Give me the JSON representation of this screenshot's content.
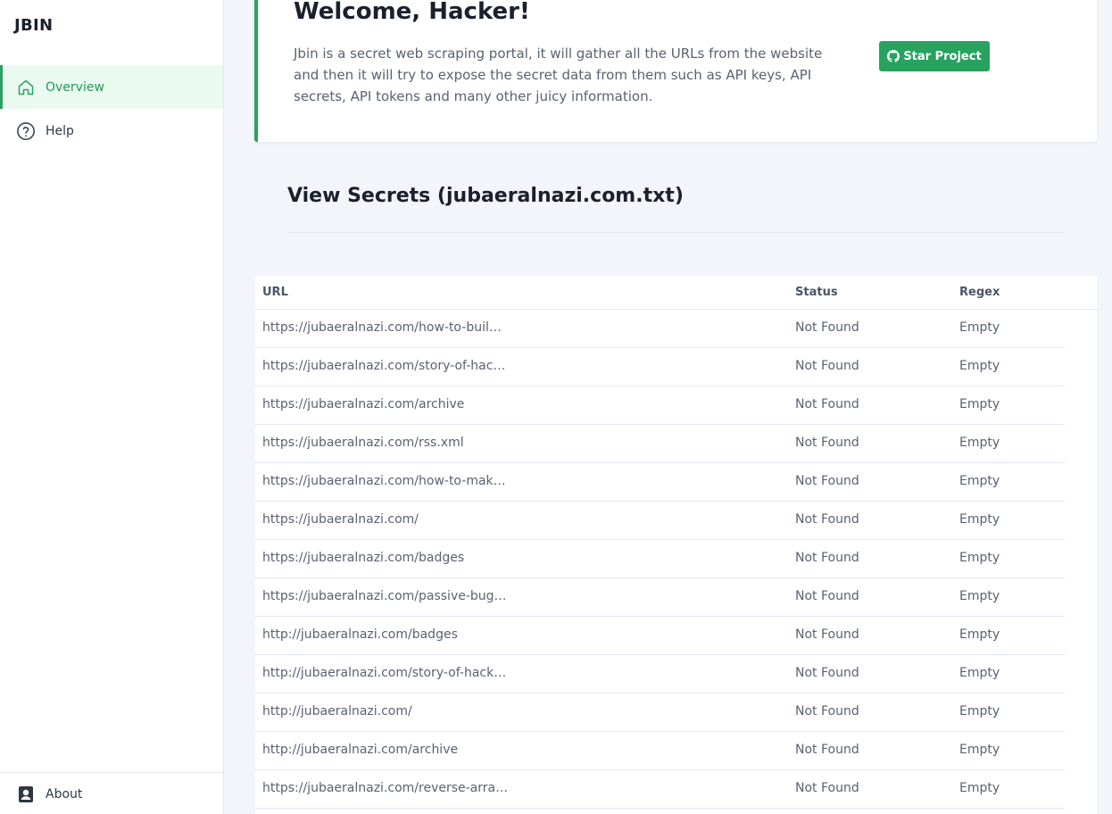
{
  "app": {
    "brand": "JBIN"
  },
  "sidebar": {
    "items": [
      {
        "label": "Overview",
        "icon": "home-icon",
        "active": true
      },
      {
        "label": "Help",
        "icon": "help-circle-icon",
        "active": false
      }
    ],
    "footer": {
      "label": "About",
      "icon": "contact-card-icon"
    }
  },
  "welcome": {
    "title": "Welcome, Hacker!",
    "description": "Jbin is a secret web scraping portal, it will gather all the URLs from the website and then it will try to expose the secret data from them such as API keys, API secrets, API tokens and many other juicy information.",
    "star_button": "Star Project",
    "star_icon": "github-icon"
  },
  "section": {
    "title": "View Secrets (jubaeralnazi.com.txt)"
  },
  "table": {
    "headers": {
      "url": "URL",
      "status": "Status",
      "regex": "Regex"
    },
    "rows": [
      {
        "url": "https://jubaeralnazi.com/how-to-buil…",
        "status": "Not Found",
        "regex": "Empty"
      },
      {
        "url": "https://jubaeralnazi.com/story-of-hac…",
        "status": "Not Found",
        "regex": "Empty"
      },
      {
        "url": "https://jubaeralnazi.com/archive",
        "status": "Not Found",
        "regex": "Empty"
      },
      {
        "url": "https://jubaeralnazi.com/rss.xml",
        "status": "Not Found",
        "regex": "Empty"
      },
      {
        "url": "https://jubaeralnazi.com/how-to-mak…",
        "status": "Not Found",
        "regex": "Empty"
      },
      {
        "url": "https://jubaeralnazi.com/",
        "status": "Not Found",
        "regex": "Empty"
      },
      {
        "url": "https://jubaeralnazi.com/badges",
        "status": "Not Found",
        "regex": "Empty"
      },
      {
        "url": "https://jubaeralnazi.com/passive-bug…",
        "status": "Not Found",
        "regex": "Empty"
      },
      {
        "url": "http://jubaeralnazi.com/badges",
        "status": "Not Found",
        "regex": "Empty"
      },
      {
        "url": "http://jubaeralnazi.com/story-of-hack…",
        "status": "Not Found",
        "regex": "Empty"
      },
      {
        "url": "http://jubaeralnazi.com/",
        "status": "Not Found",
        "regex": "Empty"
      },
      {
        "url": "http://jubaeralnazi.com/archive",
        "status": "Not Found",
        "regex": "Empty"
      },
      {
        "url": "https://jubaeralnazi.com/reverse-arra…",
        "status": "Not Found",
        "regex": "Empty"
      }
    ]
  },
  "colors": {
    "accent": "#27a35f",
    "accent_bg": "#eafaf1",
    "page_bg": "#f4f5fb"
  }
}
